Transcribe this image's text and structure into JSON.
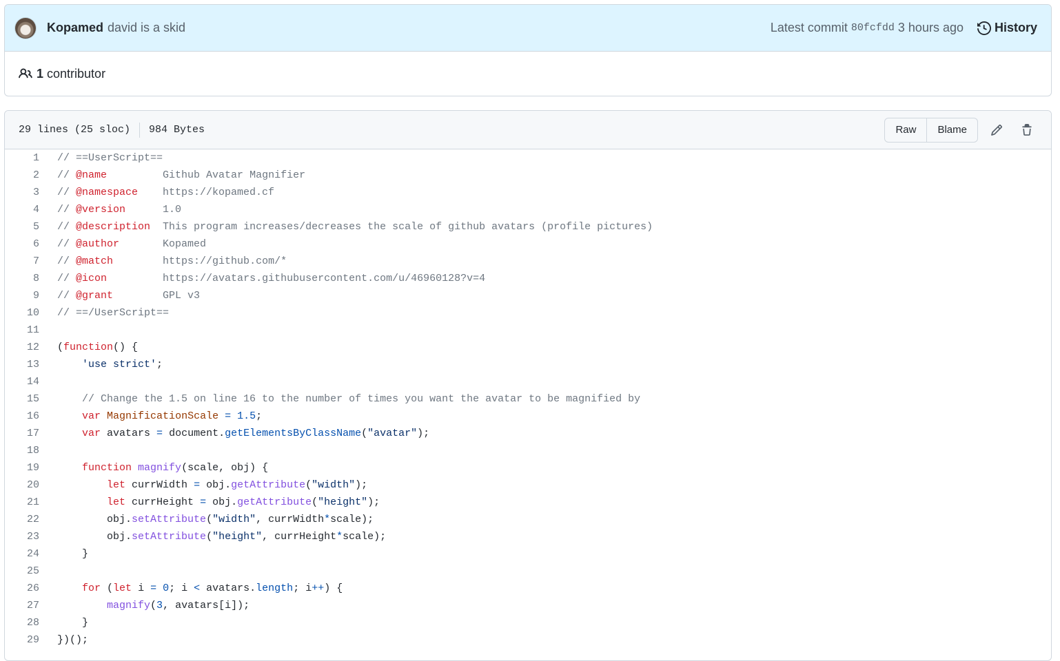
{
  "commit": {
    "author": "Kopamed",
    "message": "david is a skid",
    "latest_label": "Latest commit",
    "sha": "80fcfdd",
    "time_ago": "3 hours ago",
    "history_label": "History"
  },
  "contributors": {
    "count": "1",
    "label": "contributor"
  },
  "file": {
    "lines_info": "29 lines (25 sloc)",
    "size": "984 Bytes",
    "raw_label": "Raw",
    "blame_label": "Blame"
  },
  "icons": {
    "history": "history-icon",
    "people": "people-icon",
    "edit": "pencil-icon",
    "delete": "trash-icon"
  },
  "colors": {
    "comment": "#6e7781",
    "keyword": "#cf222e",
    "string": "#0a3069",
    "entity": "#8250df",
    "constant": "#0550ae",
    "variable": "#953800"
  },
  "code_lines": [
    [
      [
        "com",
        "// ==UserScript=="
      ]
    ],
    [
      [
        "com",
        "// "
      ],
      [
        "kw",
        "@name"
      ],
      [
        "com",
        "         Github Avatar Magnifier"
      ]
    ],
    [
      [
        "com",
        "// "
      ],
      [
        "kw",
        "@namespace"
      ],
      [
        "com",
        "    https://kopamed.cf"
      ]
    ],
    [
      [
        "com",
        "// "
      ],
      [
        "kw",
        "@version"
      ],
      [
        "com",
        "      1.0"
      ]
    ],
    [
      [
        "com",
        "// "
      ],
      [
        "kw",
        "@description"
      ],
      [
        "com",
        "  This program increases/decreases the scale of github avatars (profile pictures)"
      ]
    ],
    [
      [
        "com",
        "// "
      ],
      [
        "kw",
        "@author"
      ],
      [
        "com",
        "       Kopamed"
      ]
    ],
    [
      [
        "com",
        "// "
      ],
      [
        "kw",
        "@match"
      ],
      [
        "com",
        "        https://github.com/*"
      ]
    ],
    [
      [
        "com",
        "// "
      ],
      [
        "kw",
        "@icon"
      ],
      [
        "com",
        "         https://avatars.githubusercontent.com/u/46960128?v=4"
      ]
    ],
    [
      [
        "com",
        "// "
      ],
      [
        "kw",
        "@grant"
      ],
      [
        "com",
        "        GPL v3"
      ]
    ],
    [
      [
        "com",
        "// ==/UserScript=="
      ]
    ],
    [],
    [
      [
        "txt",
        "("
      ],
      [
        "kw",
        "function"
      ],
      [
        "txt",
        "() {"
      ]
    ],
    [
      [
        "txt",
        "    "
      ],
      [
        "str",
        "'use strict'"
      ],
      [
        "txt",
        ";"
      ]
    ],
    [],
    [
      [
        "txt",
        "    "
      ],
      [
        "com",
        "// Change the 1.5 on line 16 to the number of times you want the avatar to be magnified by"
      ]
    ],
    [
      [
        "txt",
        "    "
      ],
      [
        "kw",
        "var"
      ],
      [
        "txt",
        " "
      ],
      [
        "var",
        "MagnificationScale"
      ],
      [
        "txt",
        " "
      ],
      [
        "const",
        "="
      ],
      [
        "txt",
        " "
      ],
      [
        "const",
        "1.5"
      ],
      [
        "txt",
        ";"
      ]
    ],
    [
      [
        "txt",
        "    "
      ],
      [
        "kw",
        "var"
      ],
      [
        "txt",
        " avatars "
      ],
      [
        "const",
        "="
      ],
      [
        "txt",
        " document."
      ],
      [
        "const",
        "getElementsByClassName"
      ],
      [
        "txt",
        "("
      ],
      [
        "str",
        "\"avatar\""
      ],
      [
        "txt",
        ");"
      ]
    ],
    [],
    [
      [
        "txt",
        "    "
      ],
      [
        "kw",
        "function"
      ],
      [
        "txt",
        " "
      ],
      [
        "ent",
        "magnify"
      ],
      [
        "txt",
        "(scale, obj) {"
      ]
    ],
    [
      [
        "txt",
        "        "
      ],
      [
        "kw",
        "let"
      ],
      [
        "txt",
        " currWidth "
      ],
      [
        "const",
        "="
      ],
      [
        "txt",
        " obj."
      ],
      [
        "ent",
        "getAttribute"
      ],
      [
        "txt",
        "("
      ],
      [
        "str",
        "\"width\""
      ],
      [
        "txt",
        ");"
      ]
    ],
    [
      [
        "txt",
        "        "
      ],
      [
        "kw",
        "let"
      ],
      [
        "txt",
        " currHeight "
      ],
      [
        "const",
        "="
      ],
      [
        "txt",
        " obj."
      ],
      [
        "ent",
        "getAttribute"
      ],
      [
        "txt",
        "("
      ],
      [
        "str",
        "\"height\""
      ],
      [
        "txt",
        ");"
      ]
    ],
    [
      [
        "txt",
        "        obj."
      ],
      [
        "ent",
        "setAttribute"
      ],
      [
        "txt",
        "("
      ],
      [
        "str",
        "\"width\""
      ],
      [
        "txt",
        ", currWidth"
      ],
      [
        "const",
        "*"
      ],
      [
        "txt",
        "scale);"
      ]
    ],
    [
      [
        "txt",
        "        obj."
      ],
      [
        "ent",
        "setAttribute"
      ],
      [
        "txt",
        "("
      ],
      [
        "str",
        "\"height\""
      ],
      [
        "txt",
        ", currHeight"
      ],
      [
        "const",
        "*"
      ],
      [
        "txt",
        "scale);"
      ]
    ],
    [
      [
        "txt",
        "    }"
      ]
    ],
    [],
    [
      [
        "txt",
        "    "
      ],
      [
        "kw",
        "for"
      ],
      [
        "txt",
        " ("
      ],
      [
        "kw",
        "let"
      ],
      [
        "txt",
        " i "
      ],
      [
        "const",
        "="
      ],
      [
        "txt",
        " "
      ],
      [
        "const",
        "0"
      ],
      [
        "txt",
        "; i "
      ],
      [
        "const",
        "<"
      ],
      [
        "txt",
        " avatars."
      ],
      [
        "const",
        "length"
      ],
      [
        "txt",
        "; i"
      ],
      [
        "const",
        "++"
      ],
      [
        "txt",
        ") {"
      ]
    ],
    [
      [
        "txt",
        "        "
      ],
      [
        "ent",
        "magnify"
      ],
      [
        "txt",
        "("
      ],
      [
        "const",
        "3"
      ],
      [
        "txt",
        ", avatars[i]);"
      ]
    ],
    [
      [
        "txt",
        "    }"
      ]
    ],
    [
      [
        "txt",
        "})();"
      ]
    ]
  ]
}
